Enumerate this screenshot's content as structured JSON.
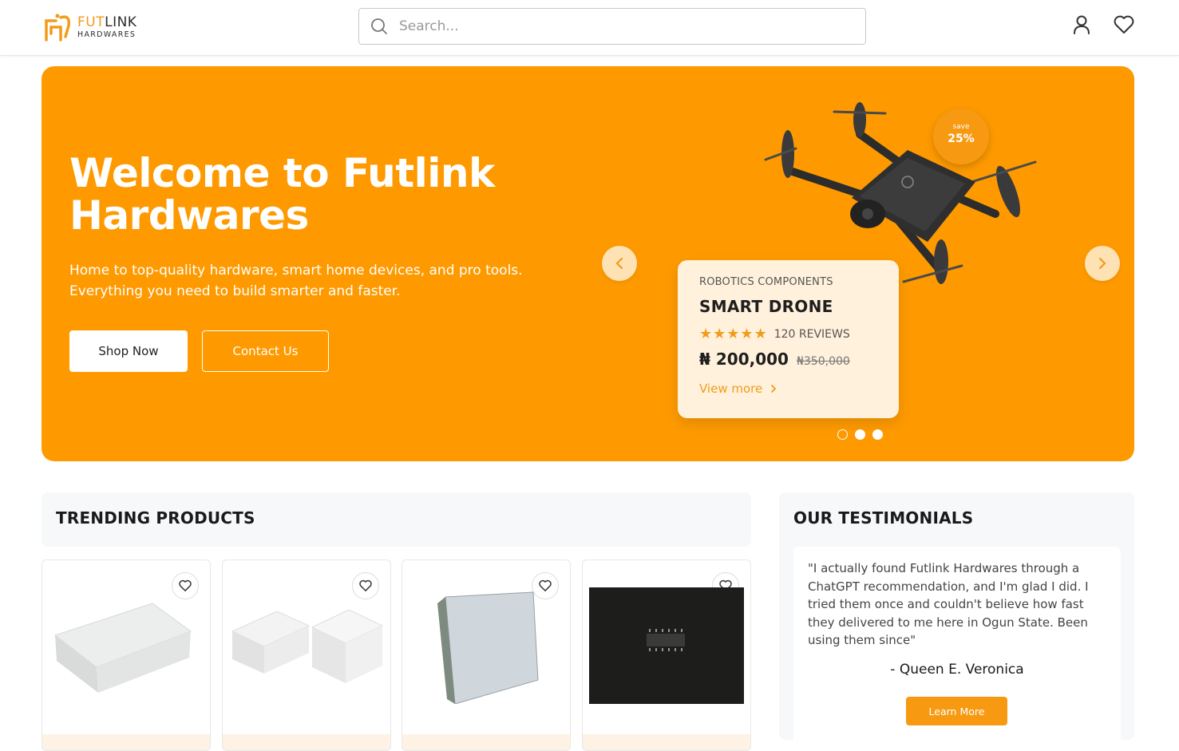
{
  "brand": {
    "name_part1": "FUT",
    "name_part2": "LINK",
    "subtitle": "HARDWARES",
    "accent": "#f29b1a"
  },
  "search": {
    "placeholder": "Search...",
    "value": ""
  },
  "header_icons": [
    "user-icon",
    "heart-icon"
  ],
  "hero": {
    "background": "#fe9a00",
    "title_line1": "Welcome to Futlink",
    "title_line2": "Hardwares",
    "subtitle": "Home to top-quality hardware, smart home devices, and pro tools. Everything you need to build smarter and faster.",
    "shop_button": "Shop Now",
    "contact_button": "Contact Us",
    "slide_count": 3,
    "active_slide": 3
  },
  "featured": {
    "badge_top": "save",
    "badge_value": "25%",
    "category": "ROBOTICS COMPONENTS",
    "name": "SMART DRONE",
    "rating": 5,
    "reviews": "120 REVIEWS",
    "price": "₦ 200,000",
    "old_price": "₦350,000",
    "view_more": "View more"
  },
  "trending": {
    "title": "TRENDING PRODUCTS",
    "products": [
      {
        "image": "white rectangular junction box"
      },
      {
        "image": "white square electrical boxes"
      },
      {
        "image": "grey waterproof enclosure"
      },
      {
        "image": "integrated circuit chip on black foam"
      }
    ]
  },
  "testimonials": {
    "title": "OUR TESTIMONIALS",
    "quote": "\"I actually found Futlink Hardwares through a ChatGPT recommendation, and I'm glad I did. I tried them once and couldn't believe how fast they delivered to me here in Ogun State. Been using them since\"",
    "author": "- Queen E. Veronica",
    "button": "Learn More"
  }
}
